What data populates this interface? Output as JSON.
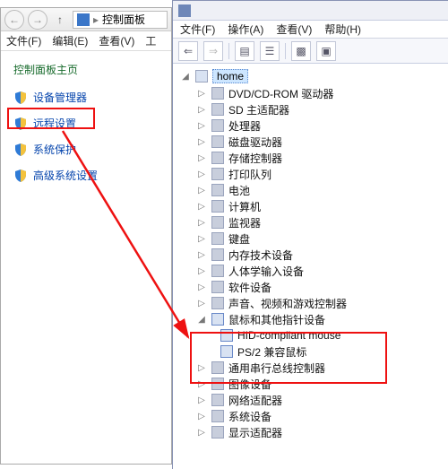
{
  "cp": {
    "title": "控制面板",
    "menu": {
      "file": "文件(F)",
      "edit": "编辑(E)",
      "view": "查看(V)",
      "tools": "工"
    },
    "home": "控制面板主页",
    "links": {
      "devmgr": "设备管理器",
      "remote": "远程设置",
      "sysprot": "系统保护",
      "advsys": "高级系统设置"
    }
  },
  "dm": {
    "menu": {
      "file": "文件(F)",
      "action": "操作(A)",
      "view": "查看(V)",
      "help": "帮助(H)"
    },
    "root": "home",
    "nodes": {
      "dvd": "DVD/CD-ROM 驱动器",
      "sd": "SD 主适配器",
      "cpu": "处理器",
      "disk": "磁盘驱动器",
      "storage": "存储控制器",
      "print": "打印队列",
      "battery": "电池",
      "computer": "计算机",
      "monitor": "监视器",
      "keyboard": "键盘",
      "memtech": "内存技术设备",
      "hid": "人体学输入设备",
      "software": "软件设备",
      "sound": "声音、视频和游戏控制器",
      "mouse": "鼠标和其他指针设备",
      "mouse_hid": "HID-compliant mouse",
      "mouse_ps2": "PS/2 兼容鼠标",
      "usb": "通用串行总线控制器",
      "image": "图像设备",
      "network": "网络适配器",
      "system": "系统设备",
      "display": "显示适配器"
    }
  }
}
